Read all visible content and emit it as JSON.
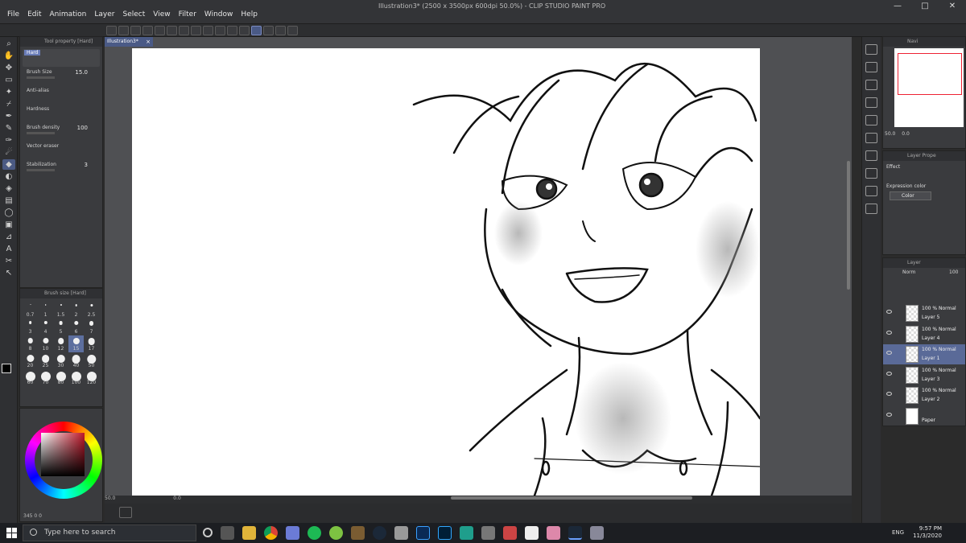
{
  "app": {
    "title": "Illustration3* (2500 x 3500px 600dpi 50.0%)  - CLIP STUDIO PAINT PRO",
    "menu": [
      "File",
      "Edit",
      "Animation",
      "Layer",
      "Select",
      "View",
      "Filter",
      "Window",
      "Help"
    ],
    "window_controls": [
      "—",
      "□",
      "✕"
    ]
  },
  "document": {
    "tab_label": "Illustration3*",
    "tab_close": "×"
  },
  "tool_property": {
    "header": "Tool property [Hard]",
    "brush_name": "Hard",
    "brush_size": {
      "label": "Brush Size",
      "value": "15.0"
    },
    "anti_alias": {
      "label": "Anti-alias"
    },
    "hardness": {
      "label": "Hardness"
    },
    "brush_density": {
      "label": "Brush density",
      "value": "100"
    },
    "vector_eraser": {
      "label": "Vector eraser"
    },
    "stabilization": {
      "label": "Stabilization",
      "value": "3"
    }
  },
  "brush_size_panel": {
    "header": "Brush size [Hard]",
    "sizes": [
      "0.7",
      "1",
      "1.5",
      "2",
      "2.5",
      "3",
      "4",
      "5",
      "6",
      "7",
      "8",
      "10",
      "12",
      "15",
      "17",
      "20",
      "25",
      "30",
      "40",
      "50",
      "60",
      "70",
      "80",
      "100",
      "120"
    ],
    "selected": "15"
  },
  "color_wheel": {
    "footer": "345  0  0",
    "accent": "#c0182b"
  },
  "canvas_status": {
    "zoom": "50.0",
    "angle": "0.0"
  },
  "navigator": {
    "header": "Navi",
    "zoom": "50.0",
    "angle": "0.0"
  },
  "layer_property": {
    "header": "Layer Prope",
    "effect_label": "Effect",
    "expression_color_label": "Expression color",
    "expression_color_value": "Color"
  },
  "layer_panel": {
    "header": "Layer",
    "blend_mode": "Norm",
    "opacity": "100",
    "layers": [
      {
        "mode": "100 % Normal",
        "name": "Layer 5",
        "selected": false
      },
      {
        "mode": "100 % Normal",
        "name": "Layer 4",
        "selected": false
      },
      {
        "mode": "100 % Normal",
        "name": "Layer 1",
        "selected": true
      },
      {
        "mode": "100 % Normal",
        "name": "Layer 3",
        "selected": false
      },
      {
        "mode": "100 % Normal",
        "name": "Layer 2",
        "selected": false
      },
      {
        "mode": "",
        "name": "Paper",
        "selected": false
      }
    ]
  },
  "taskbar": {
    "search_placeholder": "Type here to search",
    "time": "9:57 PM",
    "date": "11/3/2020",
    "language": "ENG"
  }
}
